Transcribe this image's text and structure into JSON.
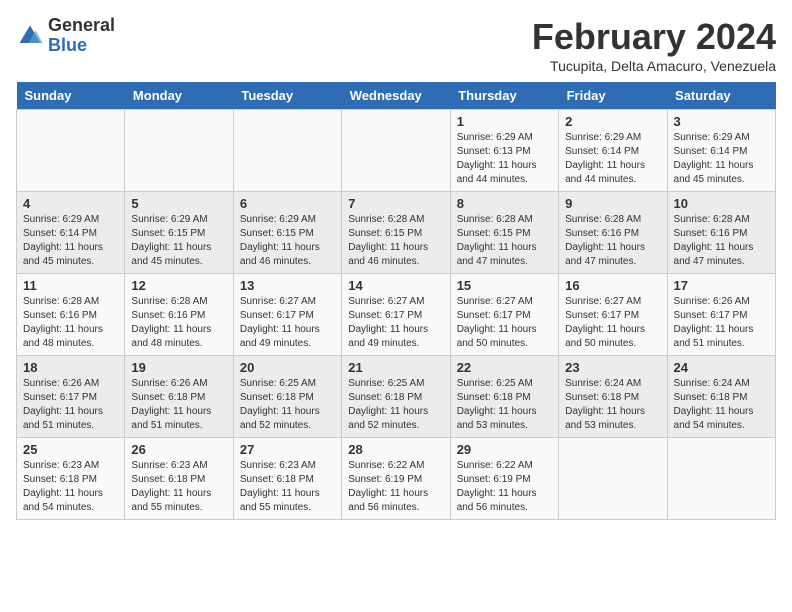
{
  "header": {
    "logo_general": "General",
    "logo_blue": "Blue",
    "month_title": "February 2024",
    "location": "Tucupita, Delta Amacuro, Venezuela"
  },
  "weekdays": [
    "Sunday",
    "Monday",
    "Tuesday",
    "Wednesday",
    "Thursday",
    "Friday",
    "Saturday"
  ],
  "weeks": [
    [
      {
        "day": "",
        "sunrise": "",
        "sunset": "",
        "daylight": ""
      },
      {
        "day": "",
        "sunrise": "",
        "sunset": "",
        "daylight": ""
      },
      {
        "day": "",
        "sunrise": "",
        "sunset": "",
        "daylight": ""
      },
      {
        "day": "",
        "sunrise": "",
        "sunset": "",
        "daylight": ""
      },
      {
        "day": "1",
        "sunrise": "Sunrise: 6:29 AM",
        "sunset": "Sunset: 6:13 PM",
        "daylight": "Daylight: 11 hours and 44 minutes."
      },
      {
        "day": "2",
        "sunrise": "Sunrise: 6:29 AM",
        "sunset": "Sunset: 6:14 PM",
        "daylight": "Daylight: 11 hours and 44 minutes."
      },
      {
        "day": "3",
        "sunrise": "Sunrise: 6:29 AM",
        "sunset": "Sunset: 6:14 PM",
        "daylight": "Daylight: 11 hours and 45 minutes."
      }
    ],
    [
      {
        "day": "4",
        "sunrise": "Sunrise: 6:29 AM",
        "sunset": "Sunset: 6:14 PM",
        "daylight": "Daylight: 11 hours and 45 minutes."
      },
      {
        "day": "5",
        "sunrise": "Sunrise: 6:29 AM",
        "sunset": "Sunset: 6:15 PM",
        "daylight": "Daylight: 11 hours and 45 minutes."
      },
      {
        "day": "6",
        "sunrise": "Sunrise: 6:29 AM",
        "sunset": "Sunset: 6:15 PM",
        "daylight": "Daylight: 11 hours and 46 minutes."
      },
      {
        "day": "7",
        "sunrise": "Sunrise: 6:28 AM",
        "sunset": "Sunset: 6:15 PM",
        "daylight": "Daylight: 11 hours and 46 minutes."
      },
      {
        "day": "8",
        "sunrise": "Sunrise: 6:28 AM",
        "sunset": "Sunset: 6:15 PM",
        "daylight": "Daylight: 11 hours and 47 minutes."
      },
      {
        "day": "9",
        "sunrise": "Sunrise: 6:28 AM",
        "sunset": "Sunset: 6:16 PM",
        "daylight": "Daylight: 11 hours and 47 minutes."
      },
      {
        "day": "10",
        "sunrise": "Sunrise: 6:28 AM",
        "sunset": "Sunset: 6:16 PM",
        "daylight": "Daylight: 11 hours and 47 minutes."
      }
    ],
    [
      {
        "day": "11",
        "sunrise": "Sunrise: 6:28 AM",
        "sunset": "Sunset: 6:16 PM",
        "daylight": "Daylight: 11 hours and 48 minutes."
      },
      {
        "day": "12",
        "sunrise": "Sunrise: 6:28 AM",
        "sunset": "Sunset: 6:16 PM",
        "daylight": "Daylight: 11 hours and 48 minutes."
      },
      {
        "day": "13",
        "sunrise": "Sunrise: 6:27 AM",
        "sunset": "Sunset: 6:17 PM",
        "daylight": "Daylight: 11 hours and 49 minutes."
      },
      {
        "day": "14",
        "sunrise": "Sunrise: 6:27 AM",
        "sunset": "Sunset: 6:17 PM",
        "daylight": "Daylight: 11 hours and 49 minutes."
      },
      {
        "day": "15",
        "sunrise": "Sunrise: 6:27 AM",
        "sunset": "Sunset: 6:17 PM",
        "daylight": "Daylight: 11 hours and 50 minutes."
      },
      {
        "day": "16",
        "sunrise": "Sunrise: 6:27 AM",
        "sunset": "Sunset: 6:17 PM",
        "daylight": "Daylight: 11 hours and 50 minutes."
      },
      {
        "day": "17",
        "sunrise": "Sunrise: 6:26 AM",
        "sunset": "Sunset: 6:17 PM",
        "daylight": "Daylight: 11 hours and 51 minutes."
      }
    ],
    [
      {
        "day": "18",
        "sunrise": "Sunrise: 6:26 AM",
        "sunset": "Sunset: 6:17 PM",
        "daylight": "Daylight: 11 hours and 51 minutes."
      },
      {
        "day": "19",
        "sunrise": "Sunrise: 6:26 AM",
        "sunset": "Sunset: 6:18 PM",
        "daylight": "Daylight: 11 hours and 51 minutes."
      },
      {
        "day": "20",
        "sunrise": "Sunrise: 6:25 AM",
        "sunset": "Sunset: 6:18 PM",
        "daylight": "Daylight: 11 hours and 52 minutes."
      },
      {
        "day": "21",
        "sunrise": "Sunrise: 6:25 AM",
        "sunset": "Sunset: 6:18 PM",
        "daylight": "Daylight: 11 hours and 52 minutes."
      },
      {
        "day": "22",
        "sunrise": "Sunrise: 6:25 AM",
        "sunset": "Sunset: 6:18 PM",
        "daylight": "Daylight: 11 hours and 53 minutes."
      },
      {
        "day": "23",
        "sunrise": "Sunrise: 6:24 AM",
        "sunset": "Sunset: 6:18 PM",
        "daylight": "Daylight: 11 hours and 53 minutes."
      },
      {
        "day": "24",
        "sunrise": "Sunrise: 6:24 AM",
        "sunset": "Sunset: 6:18 PM",
        "daylight": "Daylight: 11 hours and 54 minutes."
      }
    ],
    [
      {
        "day": "25",
        "sunrise": "Sunrise: 6:23 AM",
        "sunset": "Sunset: 6:18 PM",
        "daylight": "Daylight: 11 hours and 54 minutes."
      },
      {
        "day": "26",
        "sunrise": "Sunrise: 6:23 AM",
        "sunset": "Sunset: 6:18 PM",
        "daylight": "Daylight: 11 hours and 55 minutes."
      },
      {
        "day": "27",
        "sunrise": "Sunrise: 6:23 AM",
        "sunset": "Sunset: 6:18 PM",
        "daylight": "Daylight: 11 hours and 55 minutes."
      },
      {
        "day": "28",
        "sunrise": "Sunrise: 6:22 AM",
        "sunset": "Sunset: 6:19 PM",
        "daylight": "Daylight: 11 hours and 56 minutes."
      },
      {
        "day": "29",
        "sunrise": "Sunrise: 6:22 AM",
        "sunset": "Sunset: 6:19 PM",
        "daylight": "Daylight: 11 hours and 56 minutes."
      },
      {
        "day": "",
        "sunrise": "",
        "sunset": "",
        "daylight": ""
      },
      {
        "day": "",
        "sunrise": "",
        "sunset": "",
        "daylight": ""
      }
    ]
  ]
}
